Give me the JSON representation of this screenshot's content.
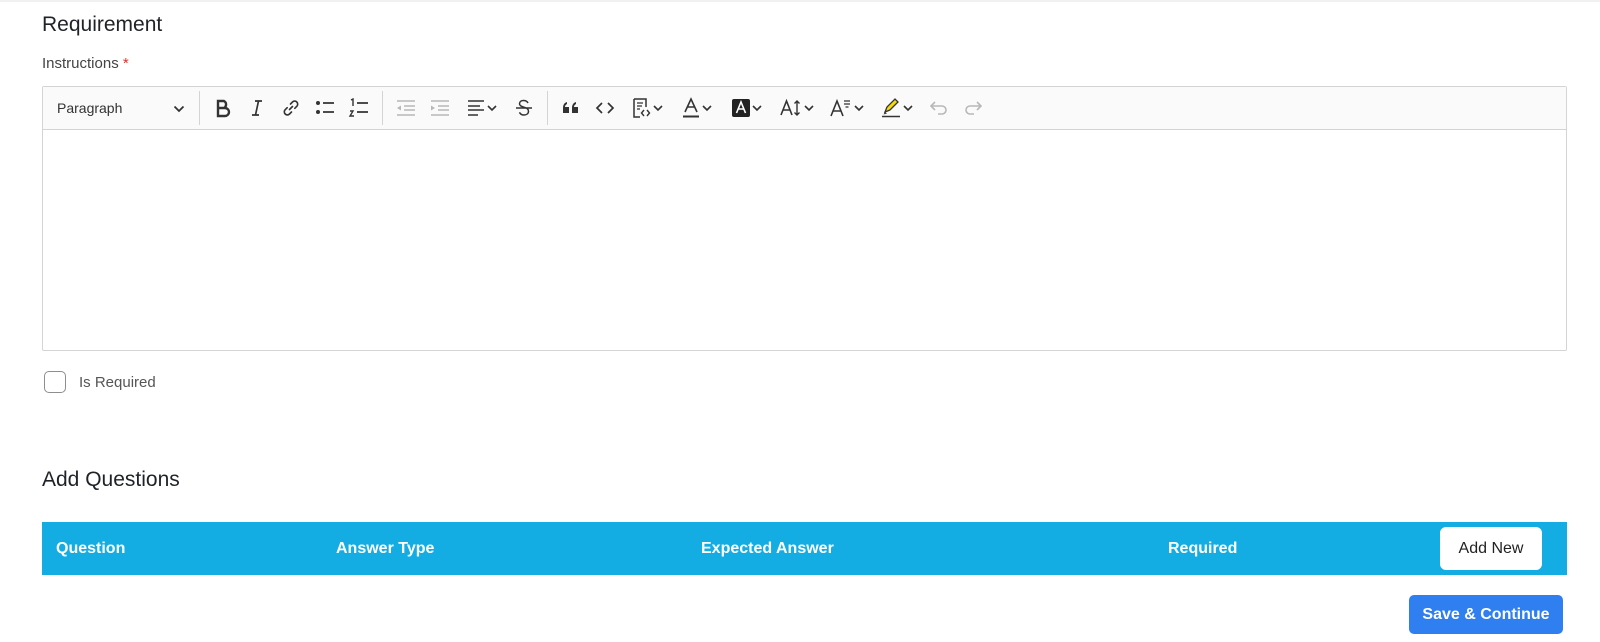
{
  "requirement": {
    "title": "Requirement",
    "instructions_label": "Instructions",
    "required_marker": "*"
  },
  "editor": {
    "block_format": "Paragraph",
    "toolbar_icons": [
      "bold-icon",
      "italic-icon",
      "link-icon",
      "bulleted-list-icon",
      "numbered-list-icon",
      "outdent-icon",
      "indent-icon",
      "align-icon",
      "strikethrough-icon",
      "quote-icon",
      "code-icon",
      "insert-code-block-icon",
      "font-color-icon",
      "background-color-icon",
      "font-size-icon",
      "font-family-icon",
      "highlight-icon",
      "undo-icon",
      "redo-icon"
    ],
    "content": ""
  },
  "is_required": {
    "label": "Is Required",
    "checked": false
  },
  "questions": {
    "title": "Add Questions",
    "columns": [
      "Question",
      "Answer Type",
      "Expected Answer",
      "Required"
    ],
    "add_new_label": "Add New",
    "header_color": "#13ade4"
  },
  "actions": {
    "save_label": "Save & Continue",
    "save_color": "#2f7ff0"
  }
}
